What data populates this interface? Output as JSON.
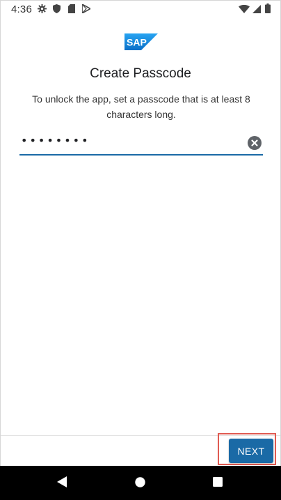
{
  "status_bar": {
    "time": "4:36",
    "icons": [
      "settings-icon",
      "shield-icon",
      "sd-card-icon",
      "play-store-icon",
      "wifi-icon",
      "signal-icon",
      "battery-icon"
    ]
  },
  "header": {
    "logo_text": "SAP",
    "title": "Create Passcode"
  },
  "instructions": "To unlock the app, set a passcode that is at least 8 characters long.",
  "passcode_field": {
    "value": "••••••••",
    "clear_icon": "clear-icon"
  },
  "actions": {
    "next_label": "NEXT"
  },
  "nav_bar": {
    "icons": [
      "back-icon",
      "home-icon",
      "recents-icon"
    ]
  },
  "colors": {
    "accent": "#1a6aa6",
    "highlight_border": "#e05b52",
    "sap_logo": "#1a7fd6"
  }
}
